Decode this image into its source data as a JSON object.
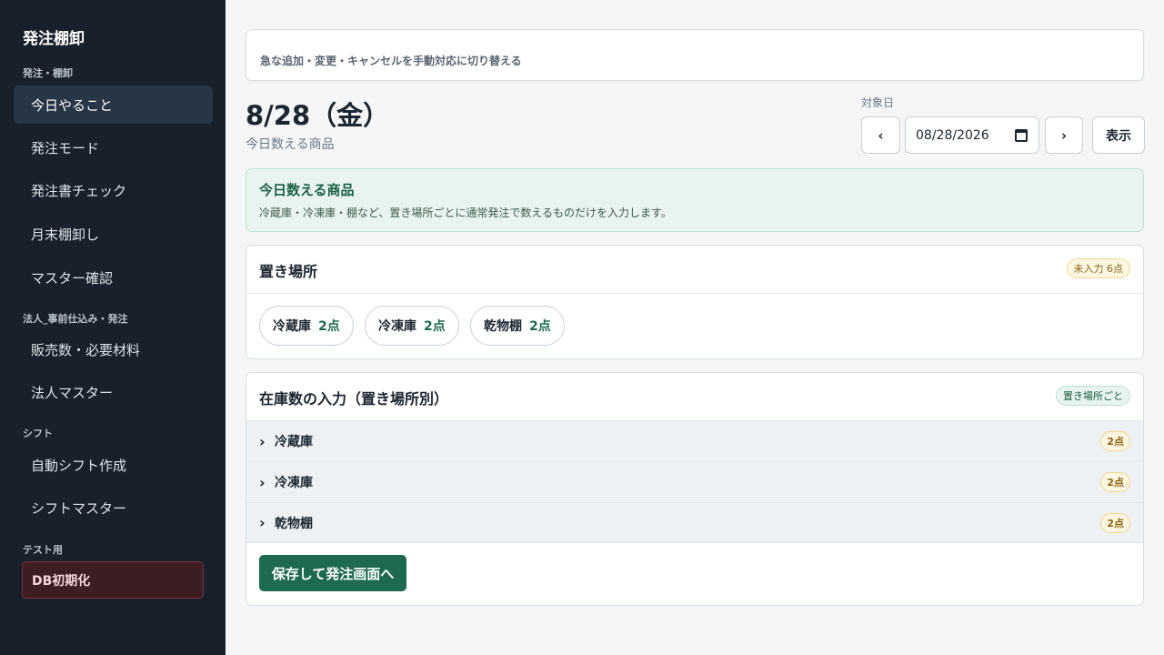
{
  "sidebar": {
    "brand": "発注棚卸",
    "sections": [
      {
        "label": "発注・棚卸"
      },
      {
        "label": "法人_事前仕込み・発注"
      },
      {
        "label": "シフト"
      },
      {
        "label": "テスト用"
      }
    ],
    "items": [
      {
        "label": "今日やること",
        "active": true
      },
      {
        "label": "発注モード"
      },
      {
        "label": "発注書チェック"
      },
      {
        "label": "月末棚卸し"
      },
      {
        "label": "マスター確認"
      },
      {
        "label": "販売数・必要材料"
      },
      {
        "label": "法人マスター"
      },
      {
        "label": "自動シフト作成"
      },
      {
        "label": "シフトマスター"
      }
    ],
    "db_reset_label": "DB初期化"
  },
  "notice": {
    "text": "急な追加・変更・キャンセルを手動対応に切り替える"
  },
  "header": {
    "title": "8/28（金）",
    "subtitle": "今日数える商品",
    "date_label": "対象日",
    "prev": "‹",
    "next": "›",
    "date_value": "08/28/2026",
    "show_label": "表示"
  },
  "info": {
    "title": "今日数える商品",
    "desc": "冷蔵庫・冷凍庫・棚など、置き場所ごとに通常発注で数えるものだけを入力します。"
  },
  "locations": {
    "title": "置き場所",
    "badge": "未入力 6点",
    "chips": [
      {
        "name": "冷蔵庫",
        "count": "2点"
      },
      {
        "name": "冷凍庫",
        "count": "2点"
      },
      {
        "name": "乾物棚",
        "count": "2点"
      }
    ]
  },
  "stock": {
    "title": "在庫数の入力（置き場所別）",
    "badge": "置き場所ごと",
    "chevron": "›",
    "rows": [
      {
        "name": "冷蔵庫",
        "count": "2点"
      },
      {
        "name": "冷凍庫",
        "count": "2点"
      },
      {
        "name": "乾物棚",
        "count": "2点"
      }
    ],
    "save_label": "保存して発注画面へ"
  },
  "colors": {
    "sidebar_bg": "#18212b",
    "accent_green": "#1d6a4e",
    "danger_bg": "#3b1d22"
  }
}
